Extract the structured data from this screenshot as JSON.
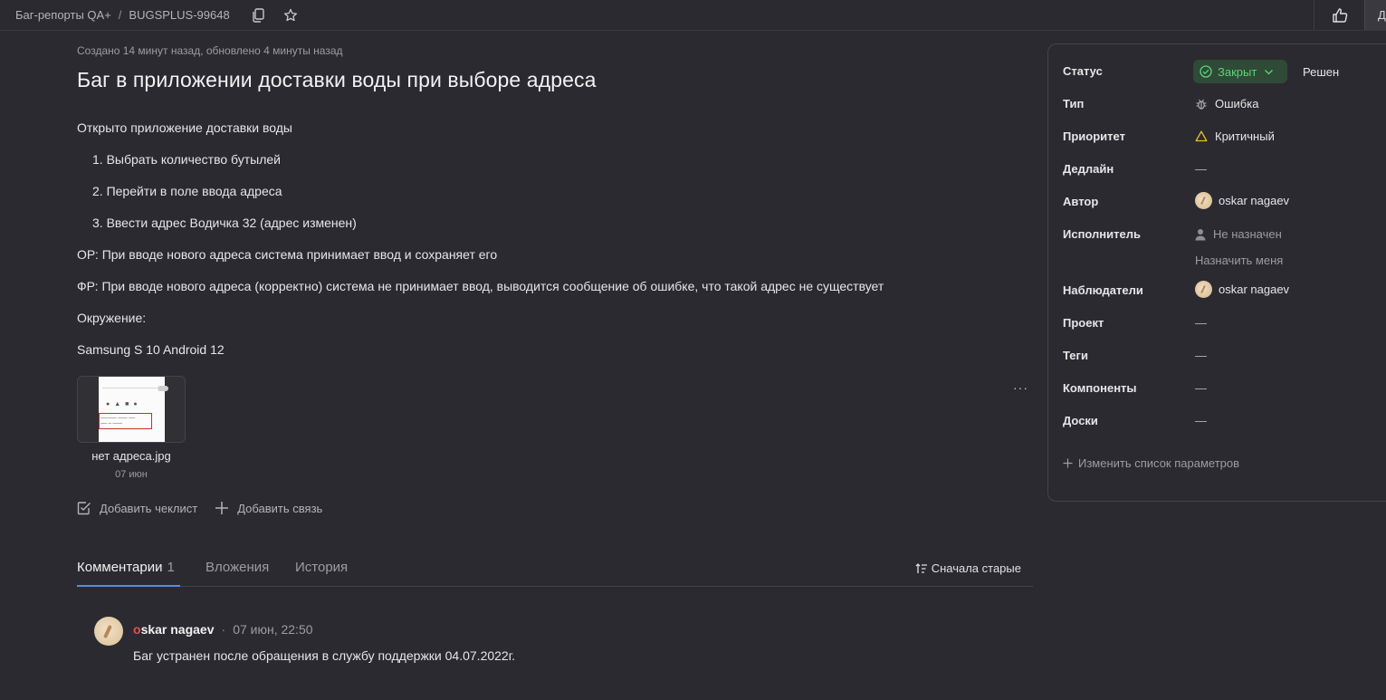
{
  "header": {
    "breadcrumb_queue": "Баг-репорты QA+",
    "breadcrumb_sep": "/",
    "breadcrumb_key": "BUGSPLUS-99648",
    "more_label": "Д"
  },
  "issue": {
    "meta": "Создано 14 минут назад, обновлено 4 минуты назад",
    "title": "Баг в приложении доставки воды при выборе адреса",
    "description": [
      "Открыто приложение доставки воды",
      "1. Выбрать количество бутылей",
      "2. Перейти в поле ввода адреса",
      "3. Ввести адрес Водичка 32 (адрес изменен)",
      "ОР: При вводе нового адреса система принимает ввод и сохраняет его",
      "ФР: При вводе нового адреса (корректно) система не принимает ввод, выводится сообщение об ошибке, что такой адрес не существует",
      "Окружение:",
      "Samsung S 10 Android 12"
    ],
    "attachment": {
      "name": "нет адреса.jpg",
      "date": "07 июн"
    },
    "actions": {
      "add_checklist": "Добавить чеклист",
      "add_link": "Добавить связь"
    },
    "more_icon": "ellipsis-icon"
  },
  "tabs": {
    "comments": "Комментарии",
    "comments_count": "1",
    "attachments": "Вложения",
    "history": "История",
    "sort": "Сначала старые"
  },
  "comment": {
    "author_first": "o",
    "author_rest": "skar nagaev",
    "dot": "·",
    "time": "07 июн, 22:50",
    "text": "Баг устранен после обращения в службу поддержки 04.07.2022г."
  },
  "panel": {
    "status_label": "Статус",
    "status_value": "Закрыт",
    "resolution": "Решен",
    "type_label": "Тип",
    "type_value": "Ошибка",
    "priority_label": "Приоритет",
    "priority_value": "Критичный",
    "deadline_label": "Дедлайн",
    "deadline_value": "—",
    "author_label": "Автор",
    "author_value": "oskar nagaev",
    "assignee_label": "Исполнитель",
    "assignee_value": "Не назначен",
    "assign_me": "Назначить меня",
    "followers_label": "Наблюдатели",
    "followers_value": "oskar nagaev",
    "project_label": "Проект",
    "project_value": "—",
    "tags_label": "Теги",
    "tags_value": "—",
    "components_label": "Компоненты",
    "components_value": "—",
    "boards_label": "Доски",
    "boards_value": "—",
    "change_params": "Изменить список параметров"
  },
  "colors": {
    "background": "#2b2a30",
    "status_green": "#5fd37a",
    "status_bg": "#2f4a36",
    "tab_accent": "#5a8ddc",
    "priority_yellow": "#e6c02e"
  }
}
